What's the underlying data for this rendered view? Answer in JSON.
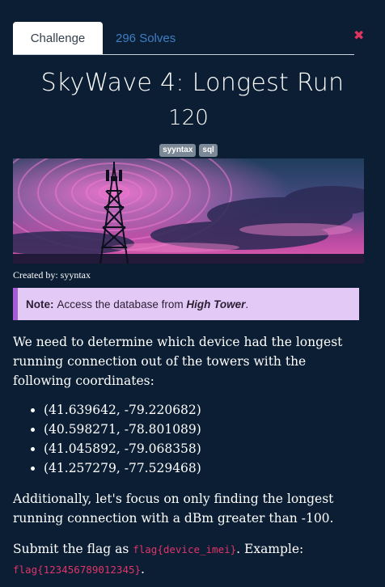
{
  "tabs": {
    "challenge": "Challenge",
    "solves": "296 Solves"
  },
  "challenge": {
    "title": "SkyWave 4: Longest Run",
    "points": "120",
    "tags": [
      "syyntax",
      "sql"
    ],
    "credit": "Created by: syyntax",
    "note_label": "Note:",
    "note_text": "Access the database from",
    "note_emphasis": "High Tower",
    "note_end": ".",
    "intro": "We need to determine which device had the longest running connection out of the towers with the following coordinates:",
    "coordinates": [
      "(41.639642, -79.220682)",
      "(40.598271, -78.801089)",
      "(41.045892, -79.068358)",
      "(41.257279, -77.529468)"
    ],
    "focus": "Additionally, let's focus on only finding the longest running connection with a dBm greater than -100.",
    "submit_prefix": "Submit the flag as",
    "flag_format": "flag{device_imei}",
    "example_label": ". Example:",
    "example_flag": "flag{123456789012345}",
    "example_end": "."
  },
  "colors": {
    "background": "#0b1e33",
    "tab_link": "#3f7fc4",
    "note_bg": "#e3caf6",
    "note_border": "#a85bd6",
    "code": "#e0346a",
    "close": "#e0345f"
  }
}
